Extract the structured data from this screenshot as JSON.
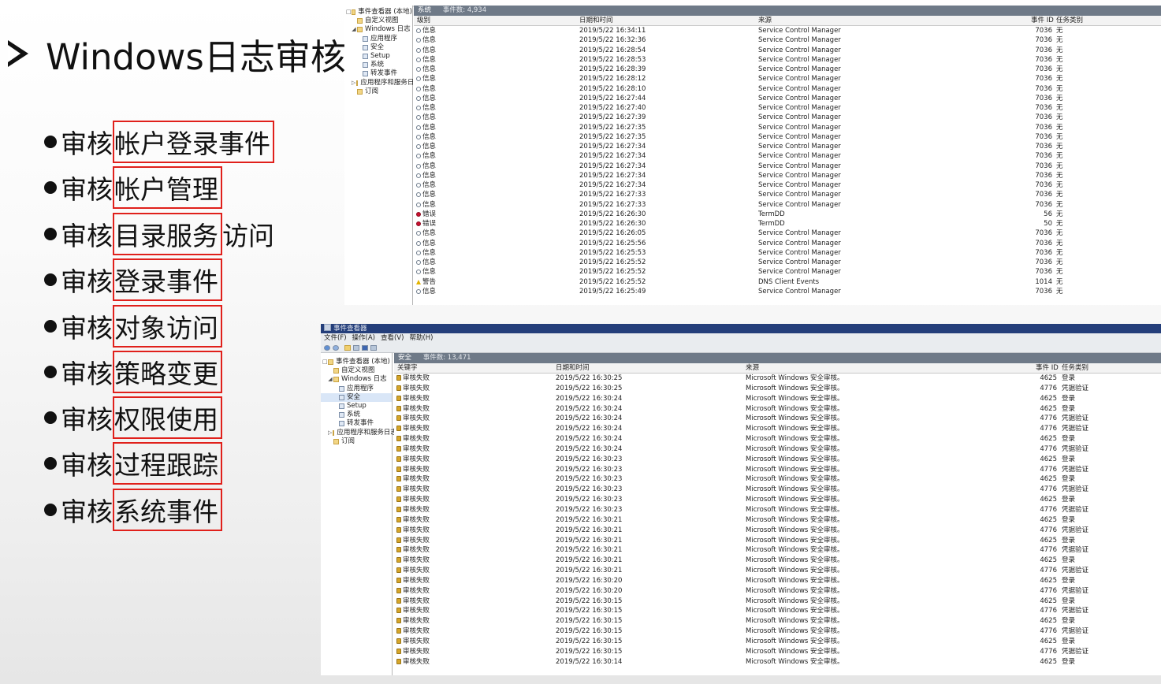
{
  "slide": {
    "title": "Windows日志审核",
    "bullet_prefix": "审核",
    "bullets": [
      {
        "highlight": "帐户登录事件",
        "rest": ""
      },
      {
        "highlight": "帐户管理",
        "rest": ""
      },
      {
        "highlight": "目录服务",
        "rest": "访问"
      },
      {
        "highlight": "登录事件",
        "rest": ""
      },
      {
        "highlight": "对象访问",
        "rest": ""
      },
      {
        "highlight": "策略变更",
        "rest": ""
      },
      {
        "highlight": "权限使用",
        "rest": ""
      },
      {
        "highlight": "过程跟踪",
        "rest": ""
      },
      {
        "highlight": "系统事件",
        "rest": ""
      }
    ],
    "highlight_color": "#e0201b"
  },
  "system_window": {
    "tree": [
      {
        "label": "事件查看器 (本地)",
        "indent": 0,
        "exp": "□",
        "icon": "folder"
      },
      {
        "label": "自定义视图",
        "indent": 1,
        "exp": "",
        "icon": "folder"
      },
      {
        "label": "Windows 日志",
        "indent": 1,
        "exp": "◢",
        "icon": "folder"
      },
      {
        "label": "应用程序",
        "indent": 2,
        "exp": "",
        "icon": "log"
      },
      {
        "label": "安全",
        "indent": 2,
        "exp": "",
        "icon": "log"
      },
      {
        "label": "Setup",
        "indent": 2,
        "exp": "",
        "icon": "log"
      },
      {
        "label": "系统",
        "indent": 2,
        "exp": "",
        "icon": "log"
      },
      {
        "label": "转发事件",
        "indent": 2,
        "exp": "",
        "icon": "log"
      },
      {
        "label": "应用程序和服务日志",
        "indent": 1,
        "exp": "▷",
        "icon": "folder"
      },
      {
        "label": "订阅",
        "indent": 1,
        "exp": "",
        "icon": "folder"
      }
    ],
    "log_name": "系统",
    "count": "事件数: 4,934",
    "headers": {
      "level": "级别",
      "datetime": "日期和时间",
      "source": "来源",
      "id": "事件 ID",
      "task": "任务类别"
    },
    "rows": [
      {
        "level": "信息",
        "type": "info",
        "datetime": "2019/5/22 16:34:11",
        "source": "Service Control Manager",
        "id": "7036",
        "task": "无"
      },
      {
        "level": "信息",
        "type": "info",
        "datetime": "2019/5/22 16:32:36",
        "source": "Service Control Manager",
        "id": "7036",
        "task": "无"
      },
      {
        "level": "信息",
        "type": "info",
        "datetime": "2019/5/22 16:28:54",
        "source": "Service Control Manager",
        "id": "7036",
        "task": "无"
      },
      {
        "level": "信息",
        "type": "info",
        "datetime": "2019/5/22 16:28:53",
        "source": "Service Control Manager",
        "id": "7036",
        "task": "无"
      },
      {
        "level": "信息",
        "type": "info",
        "datetime": "2019/5/22 16:28:39",
        "source": "Service Control Manager",
        "id": "7036",
        "task": "无"
      },
      {
        "level": "信息",
        "type": "info",
        "datetime": "2019/5/22 16:28:12",
        "source": "Service Control Manager",
        "id": "7036",
        "task": "无"
      },
      {
        "level": "信息",
        "type": "info",
        "datetime": "2019/5/22 16:28:10",
        "source": "Service Control Manager",
        "id": "7036",
        "task": "无"
      },
      {
        "level": "信息",
        "type": "info",
        "datetime": "2019/5/22 16:27:44",
        "source": "Service Control Manager",
        "id": "7036",
        "task": "无"
      },
      {
        "level": "信息",
        "type": "info",
        "datetime": "2019/5/22 16:27:40",
        "source": "Service Control Manager",
        "id": "7036",
        "task": "无"
      },
      {
        "level": "信息",
        "type": "info",
        "datetime": "2019/5/22 16:27:39",
        "source": "Service Control Manager",
        "id": "7036",
        "task": "无"
      },
      {
        "level": "信息",
        "type": "info",
        "datetime": "2019/5/22 16:27:35",
        "source": "Service Control Manager",
        "id": "7036",
        "task": "无"
      },
      {
        "level": "信息",
        "type": "info",
        "datetime": "2019/5/22 16:27:35",
        "source": "Service Control Manager",
        "id": "7036",
        "task": "无"
      },
      {
        "level": "信息",
        "type": "info",
        "datetime": "2019/5/22 16:27:34",
        "source": "Service Control Manager",
        "id": "7036",
        "task": "无"
      },
      {
        "level": "信息",
        "type": "info",
        "datetime": "2019/5/22 16:27:34",
        "source": "Service Control Manager",
        "id": "7036",
        "task": "无"
      },
      {
        "level": "信息",
        "type": "info",
        "datetime": "2019/5/22 16:27:34",
        "source": "Service Control Manager",
        "id": "7036",
        "task": "无"
      },
      {
        "level": "信息",
        "type": "info",
        "datetime": "2019/5/22 16:27:34",
        "source": "Service Control Manager",
        "id": "7036",
        "task": "无"
      },
      {
        "level": "信息",
        "type": "info",
        "datetime": "2019/5/22 16:27:34",
        "source": "Service Control Manager",
        "id": "7036",
        "task": "无"
      },
      {
        "level": "信息",
        "type": "info",
        "datetime": "2019/5/22 16:27:33",
        "source": "Service Control Manager",
        "id": "7036",
        "task": "无"
      },
      {
        "level": "信息",
        "type": "info",
        "datetime": "2019/5/22 16:27:33",
        "source": "Service Control Manager",
        "id": "7036",
        "task": "无"
      },
      {
        "level": "错误",
        "type": "err",
        "datetime": "2019/5/22 16:26:30",
        "source": "TermDD",
        "id": "56",
        "task": "无"
      },
      {
        "level": "错误",
        "type": "err",
        "datetime": "2019/5/22 16:26:30",
        "source": "TermDD",
        "id": "50",
        "task": "无"
      },
      {
        "level": "信息",
        "type": "info",
        "datetime": "2019/5/22 16:26:05",
        "source": "Service Control Manager",
        "id": "7036",
        "task": "无"
      },
      {
        "level": "信息",
        "type": "info",
        "datetime": "2019/5/22 16:25:56",
        "source": "Service Control Manager",
        "id": "7036",
        "task": "无"
      },
      {
        "level": "信息",
        "type": "info",
        "datetime": "2019/5/22 16:25:53",
        "source": "Service Control Manager",
        "id": "7036",
        "task": "无"
      },
      {
        "level": "信息",
        "type": "info",
        "datetime": "2019/5/22 16:25:52",
        "source": "Service Control Manager",
        "id": "7036",
        "task": "无"
      },
      {
        "level": "信息",
        "type": "info",
        "datetime": "2019/5/22 16:25:52",
        "source": "Service Control Manager",
        "id": "7036",
        "task": "无"
      },
      {
        "level": "警告",
        "type": "warn",
        "datetime": "2019/5/22 16:25:52",
        "source": "DNS Client Events",
        "id": "1014",
        "task": "无"
      },
      {
        "level": "信息",
        "type": "info",
        "datetime": "2019/5/22 16:25:49",
        "source": "Service Control Manager",
        "id": "7036",
        "task": "无"
      }
    ]
  },
  "security_window": {
    "title": "事件查看器",
    "menu": [
      "文件(F)",
      "操作(A)",
      "查看(V)",
      "帮助(H)"
    ],
    "tree": [
      {
        "label": "事件查看器 (本地)",
        "indent": 0,
        "exp": "□",
        "icon": "folder"
      },
      {
        "label": "自定义视图",
        "indent": 1,
        "exp": "",
        "icon": "folder"
      },
      {
        "label": "Windows 日志",
        "indent": 1,
        "exp": "◢",
        "icon": "folder"
      },
      {
        "label": "应用程序",
        "indent": 2,
        "exp": "",
        "icon": "log"
      },
      {
        "label": "安全",
        "indent": 2,
        "exp": "",
        "icon": "log",
        "selected": true
      },
      {
        "label": "Setup",
        "indent": 2,
        "exp": "",
        "icon": "log"
      },
      {
        "label": "系统",
        "indent": 2,
        "exp": "",
        "icon": "log"
      },
      {
        "label": "转发事件",
        "indent": 2,
        "exp": "",
        "icon": "log"
      },
      {
        "label": "应用程序和服务日志",
        "indent": 1,
        "exp": "▷",
        "icon": "folder"
      },
      {
        "label": "订阅",
        "indent": 1,
        "exp": "",
        "icon": "folder"
      }
    ],
    "log_name": "安全",
    "count": "事件数: 13,471",
    "headers": {
      "keyword": "关键字",
      "datetime": "日期和时间",
      "source": "来源",
      "id": "事件 ID",
      "task": "任务类别"
    },
    "rows": [
      {
        "keyword": "审核失败",
        "datetime": "2019/5/22 16:30:25",
        "source": "Microsoft Windows 安全审核。",
        "id": "4625",
        "task": "登录"
      },
      {
        "keyword": "审核失败",
        "datetime": "2019/5/22 16:30:25",
        "source": "Microsoft Windows 安全审核。",
        "id": "4776",
        "task": "凭据验证"
      },
      {
        "keyword": "审核失败",
        "datetime": "2019/5/22 16:30:24",
        "source": "Microsoft Windows 安全审核。",
        "id": "4625",
        "task": "登录"
      },
      {
        "keyword": "审核失败",
        "datetime": "2019/5/22 16:30:24",
        "source": "Microsoft Windows 安全审核。",
        "id": "4625",
        "task": "登录"
      },
      {
        "keyword": "审核失败",
        "datetime": "2019/5/22 16:30:24",
        "source": "Microsoft Windows 安全审核。",
        "id": "4776",
        "task": "凭据验证"
      },
      {
        "keyword": "审核失败",
        "datetime": "2019/5/22 16:30:24",
        "source": "Microsoft Windows 安全审核。",
        "id": "4776",
        "task": "凭据验证"
      },
      {
        "keyword": "审核失败",
        "datetime": "2019/5/22 16:30:24",
        "source": "Microsoft Windows 安全审核。",
        "id": "4625",
        "task": "登录"
      },
      {
        "keyword": "审核失败",
        "datetime": "2019/5/22 16:30:24",
        "source": "Microsoft Windows 安全审核。",
        "id": "4776",
        "task": "凭据验证"
      },
      {
        "keyword": "审核失败",
        "datetime": "2019/5/22 16:30:23",
        "source": "Microsoft Windows 安全审核。",
        "id": "4625",
        "task": "登录"
      },
      {
        "keyword": "审核失败",
        "datetime": "2019/5/22 16:30:23",
        "source": "Microsoft Windows 安全审核。",
        "id": "4776",
        "task": "凭据验证"
      },
      {
        "keyword": "审核失败",
        "datetime": "2019/5/22 16:30:23",
        "source": "Microsoft Windows 安全审核。",
        "id": "4625",
        "task": "登录"
      },
      {
        "keyword": "审核失败",
        "datetime": "2019/5/22 16:30:23",
        "source": "Microsoft Windows 安全审核。",
        "id": "4776",
        "task": "凭据验证"
      },
      {
        "keyword": "审核失败",
        "datetime": "2019/5/22 16:30:23",
        "source": "Microsoft Windows 安全审核。",
        "id": "4625",
        "task": "登录"
      },
      {
        "keyword": "审核失败",
        "datetime": "2019/5/22 16:30:23",
        "source": "Microsoft Windows 安全审核。",
        "id": "4776",
        "task": "凭据验证"
      },
      {
        "keyword": "审核失败",
        "datetime": "2019/5/22 16:30:21",
        "source": "Microsoft Windows 安全审核。",
        "id": "4625",
        "task": "登录"
      },
      {
        "keyword": "审核失败",
        "datetime": "2019/5/22 16:30:21",
        "source": "Microsoft Windows 安全审核。",
        "id": "4776",
        "task": "凭据验证"
      },
      {
        "keyword": "审核失败",
        "datetime": "2019/5/22 16:30:21",
        "source": "Microsoft Windows 安全审核。",
        "id": "4625",
        "task": "登录"
      },
      {
        "keyword": "审核失败",
        "datetime": "2019/5/22 16:30:21",
        "source": "Microsoft Windows 安全审核。",
        "id": "4776",
        "task": "凭据验证"
      },
      {
        "keyword": "审核失败",
        "datetime": "2019/5/22 16:30:21",
        "source": "Microsoft Windows 安全审核。",
        "id": "4625",
        "task": "登录"
      },
      {
        "keyword": "审核失败",
        "datetime": "2019/5/22 16:30:21",
        "source": "Microsoft Windows 安全审核。",
        "id": "4776",
        "task": "凭据验证"
      },
      {
        "keyword": "审核失败",
        "datetime": "2019/5/22 16:30:20",
        "source": "Microsoft Windows 安全审核。",
        "id": "4625",
        "task": "登录"
      },
      {
        "keyword": "审核失败",
        "datetime": "2019/5/22 16:30:20",
        "source": "Microsoft Windows 安全审核。",
        "id": "4776",
        "task": "凭据验证"
      },
      {
        "keyword": "审核失败",
        "datetime": "2019/5/22 16:30:15",
        "source": "Microsoft Windows 安全审核。",
        "id": "4625",
        "task": "登录"
      },
      {
        "keyword": "审核失败",
        "datetime": "2019/5/22 16:30:15",
        "source": "Microsoft Windows 安全审核。",
        "id": "4776",
        "task": "凭据验证"
      },
      {
        "keyword": "审核失败",
        "datetime": "2019/5/22 16:30:15",
        "source": "Microsoft Windows 安全审核。",
        "id": "4625",
        "task": "登录"
      },
      {
        "keyword": "审核失败",
        "datetime": "2019/5/22 16:30:15",
        "source": "Microsoft Windows 安全审核。",
        "id": "4776",
        "task": "凭据验证"
      },
      {
        "keyword": "审核失败",
        "datetime": "2019/5/22 16:30:15",
        "source": "Microsoft Windows 安全审核。",
        "id": "4625",
        "task": "登录"
      },
      {
        "keyword": "审核失败",
        "datetime": "2019/5/22 16:30:15",
        "source": "Microsoft Windows 安全审核。",
        "id": "4776",
        "task": "凭据验证"
      },
      {
        "keyword": "审核失败",
        "datetime": "2019/5/22 16:30:14",
        "source": "Microsoft Windows 安全审核。",
        "id": "4625",
        "task": "登录"
      }
    ]
  }
}
